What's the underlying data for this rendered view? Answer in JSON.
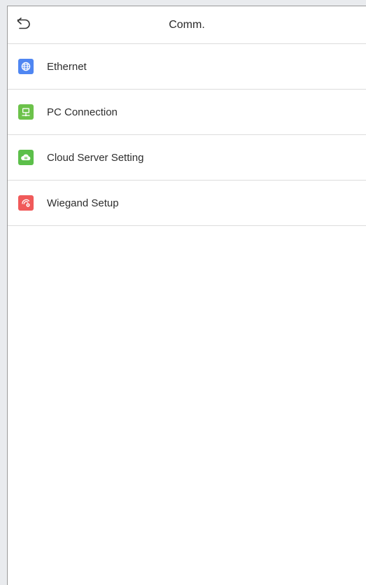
{
  "header": {
    "title": "Comm.",
    "back_icon": "back-arrow-icon"
  },
  "menu": {
    "items": [
      {
        "label": "Ethernet",
        "icon": "globe-icon",
        "color": "#4f86f2"
      },
      {
        "label": "PC Connection",
        "icon": "monitor-icon",
        "color": "#6cc24a"
      },
      {
        "label": "Cloud Server Setting",
        "icon": "cloud-icon",
        "color": "#5cbf4a"
      },
      {
        "label": "Wiegand Setup",
        "icon": "wiegand-icon",
        "color": "#f05a5a"
      }
    ]
  }
}
